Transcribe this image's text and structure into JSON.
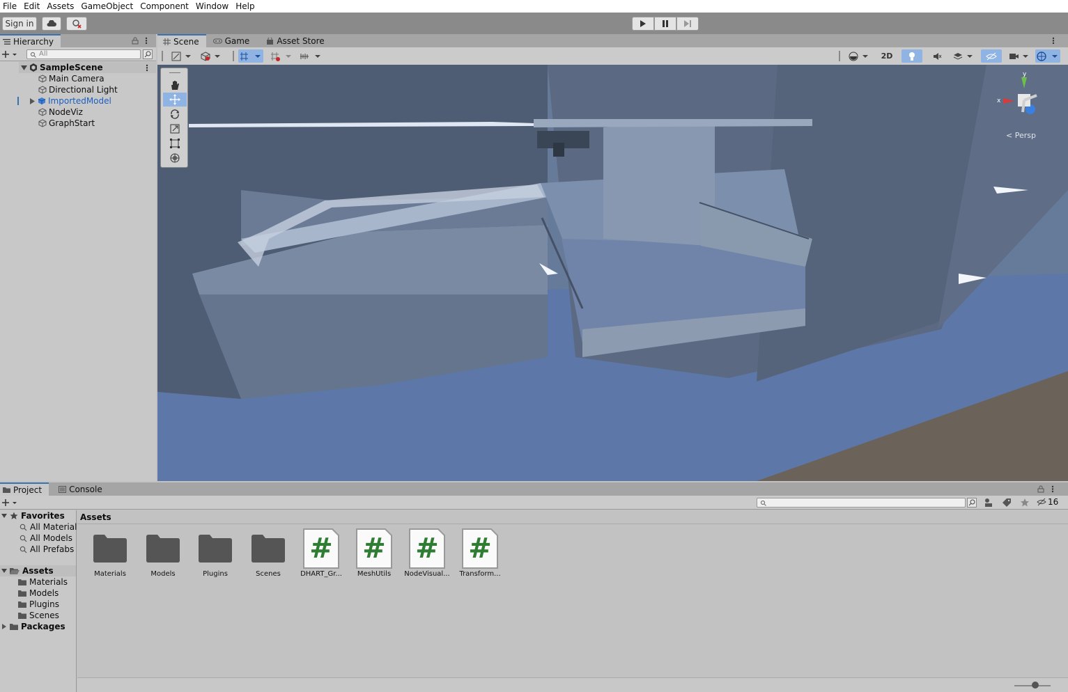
{
  "menu": [
    "File",
    "Edit",
    "Assets",
    "GameObject",
    "Component",
    "Window",
    "Help"
  ],
  "toolbar": {
    "sign_in": "Sign in"
  },
  "hierarchy": {
    "tab_label": "Hierarchy",
    "search_placeholder": "All",
    "scene_name": "SampleScene",
    "items": [
      "Main Camera",
      "Directional Light",
      "ImportedModel",
      "NodeViz",
      "GraphStart"
    ]
  },
  "scene": {
    "tabs": [
      "Scene",
      "Game",
      "Asset Store"
    ],
    "mode_2d": "2D",
    "persp_label": "Persp",
    "axis_x": "x",
    "axis_y": "y"
  },
  "project": {
    "tabs": [
      "Project",
      "Console"
    ],
    "visible_count": "16",
    "breadcrumb": "Assets",
    "favorites": {
      "label": "Favorites",
      "items": [
        "All Materials",
        "All Models",
        "All Prefabs"
      ]
    },
    "assets_folder": {
      "label": "Assets",
      "children": [
        "Materials",
        "Models",
        "Plugins",
        "Scenes"
      ]
    },
    "packages": "Packages",
    "grid": [
      {
        "name": "Materials",
        "type": "folder"
      },
      {
        "name": "Models",
        "type": "folder"
      },
      {
        "name": "Plugins",
        "type": "folder"
      },
      {
        "name": "Scenes",
        "type": "folder"
      },
      {
        "name": "DHART_Gr...",
        "type": "script"
      },
      {
        "name": "MeshUtils",
        "type": "script"
      },
      {
        "name": "NodeVisual...",
        "type": "script"
      },
      {
        "name": "Transform...",
        "type": "script"
      }
    ],
    "script_glyph": "#"
  },
  "colors": {
    "accent": "#3a72b0",
    "script_green": "#2e7d32",
    "selected_text": "#1d5fbf"
  }
}
